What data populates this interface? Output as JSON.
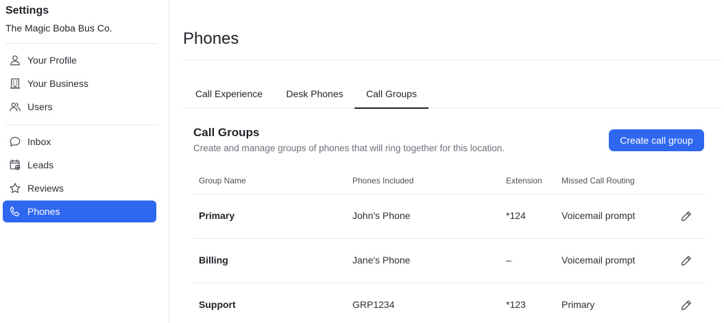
{
  "sidebar": {
    "title": "Settings",
    "company": "The Magic Boba Bus Co.",
    "group1": [
      {
        "label": "Your Profile",
        "icon": "person-icon"
      },
      {
        "label": "Your Business",
        "icon": "building-icon"
      },
      {
        "label": "Users",
        "icon": "users-icon"
      }
    ],
    "group2": [
      {
        "label": "Inbox",
        "icon": "chat-bubble-icon"
      },
      {
        "label": "Leads",
        "icon": "calendar-plus-icon"
      },
      {
        "label": "Reviews",
        "icon": "star-icon"
      },
      {
        "label": "Phones",
        "icon": "phone-icon",
        "active": true
      }
    ]
  },
  "main": {
    "title": "Phones",
    "tabs": [
      {
        "label": "Call Experience"
      },
      {
        "label": "Desk Phones"
      },
      {
        "label": "Call Groups",
        "active": true
      }
    ],
    "section": {
      "title": "Call Groups",
      "description": "Create and manage groups of phones that will ring together for this location.",
      "create_button": "Create call group"
    },
    "table": {
      "headers": [
        "Group Name",
        "Phones Included",
        "Extension",
        "Missed Call Routing"
      ],
      "rows": [
        {
          "name": "Primary",
          "phones": "John's Phone",
          "extension": "*124",
          "routing": "Voicemail prompt"
        },
        {
          "name": "Billing",
          "phones": "Jane's Phone",
          "extension": "–",
          "routing": "Voicemail prompt"
        },
        {
          "name": "Support",
          "phones": "GRP1234",
          "extension": "*123",
          "routing": "Primary"
        }
      ]
    }
  },
  "colors": {
    "accent": "#3067f0",
    "divider": "#e4e6ea",
    "muted_text": "#6b717a"
  }
}
